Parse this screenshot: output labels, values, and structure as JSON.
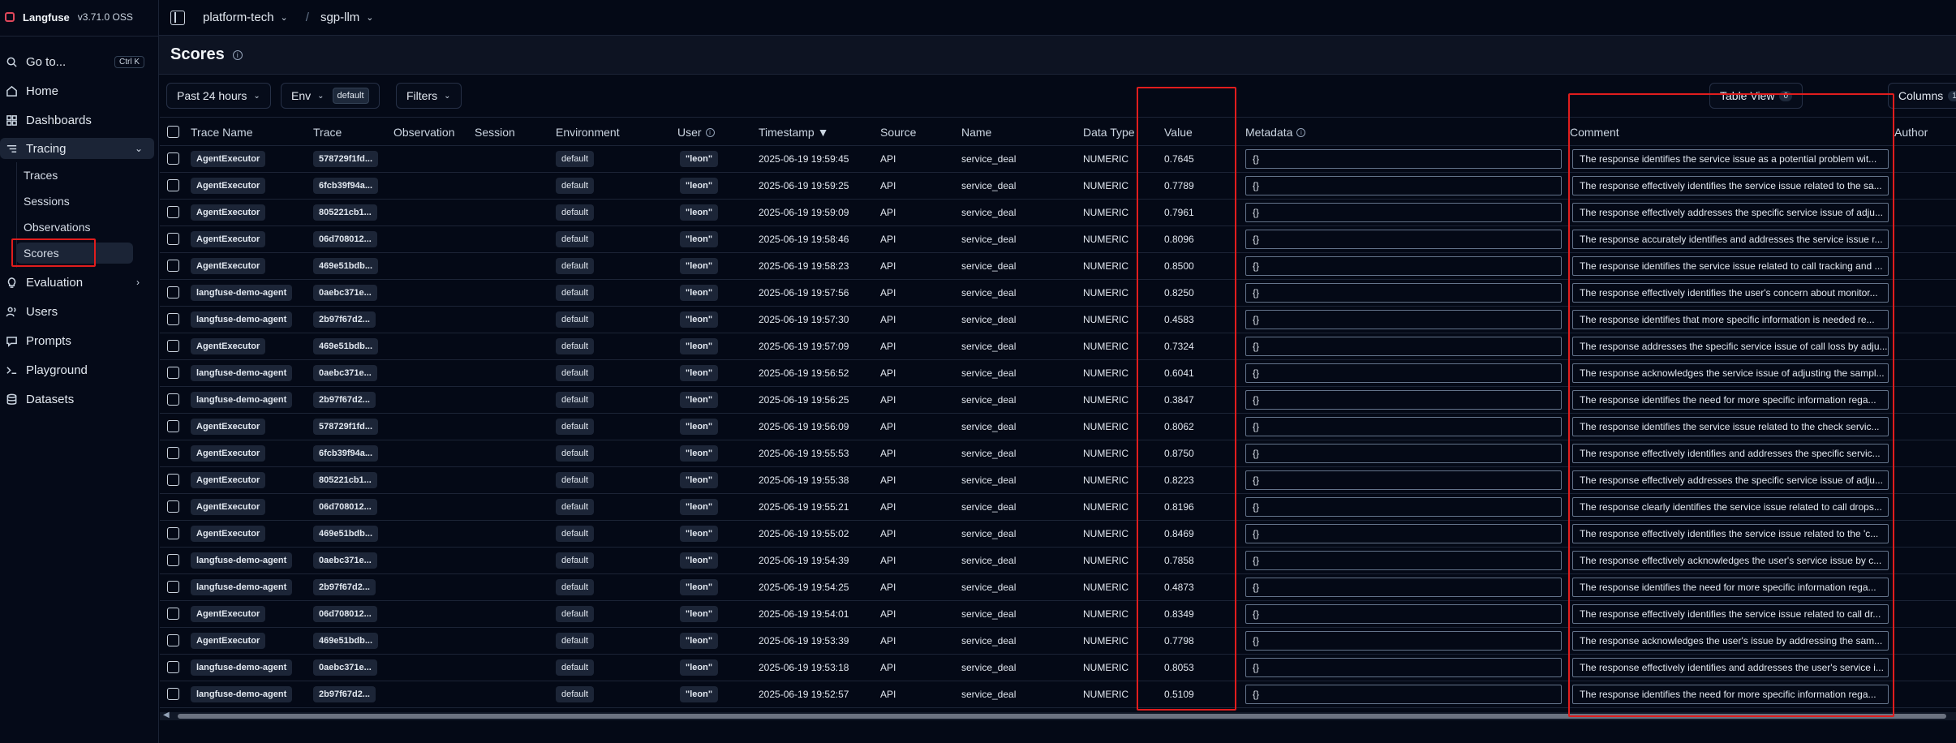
{
  "app": {
    "name": "Langfuse",
    "version": "v3.71.0 OSS"
  },
  "sidebar": {
    "goto": {
      "label": "Go to...",
      "shortcut": "Ctrl K"
    },
    "items": [
      {
        "label": "Home",
        "icon": "home-icon"
      },
      {
        "label": "Dashboards",
        "icon": "dashboard-icon"
      },
      {
        "label": "Tracing",
        "icon": "tracing-icon"
      },
      {
        "label": "Evaluation",
        "icon": "lightbulb-icon"
      },
      {
        "label": "Users",
        "icon": "users-icon"
      },
      {
        "label": "Prompts",
        "icon": "prompts-icon"
      },
      {
        "label": "Playground",
        "icon": "terminal-icon"
      },
      {
        "label": "Datasets",
        "icon": "database-icon"
      }
    ],
    "tracing_sub": [
      "Traces",
      "Sessions",
      "Observations",
      "Scores"
    ]
  },
  "breadcrumb": {
    "org": "platform-tech",
    "separator": "/",
    "project": "sgp-llm"
  },
  "page": {
    "title": "Scores",
    "info_icon": "info-icon"
  },
  "toolbar": {
    "time_range": "Past 24 hours",
    "env_label": "Env",
    "env_value": "default",
    "filters": "Filters",
    "table_view": "Table View",
    "table_view_count": "0",
    "columns": "Columns",
    "columns_count": "1"
  },
  "table": {
    "headers": {
      "trace_name": "Trace Name",
      "trace": "Trace",
      "observation": "Observation",
      "session": "Session",
      "environment": "Environment",
      "user": "User",
      "timestamp": "Timestamp ▼",
      "source": "Source",
      "name": "Name",
      "data_type": "Data Type",
      "value": "Value",
      "metadata": "Metadata",
      "comment": "Comment",
      "author": "Author"
    },
    "rows": [
      {
        "trace_name": "AgentExecutor",
        "trace": "578729f1fd...",
        "env": "default",
        "user": "\"leon\"",
        "ts": "2025-06-19 19:59:45",
        "source": "API",
        "name": "service_deal",
        "dtype": "NUMERIC",
        "value": "0.7645",
        "meta": "{}",
        "comment": "The response identifies the service issue as a potential problem wit..."
      },
      {
        "trace_name": "AgentExecutor",
        "trace": "6fcb39f94a...",
        "env": "default",
        "user": "\"leon\"",
        "ts": "2025-06-19 19:59:25",
        "source": "API",
        "name": "service_deal",
        "dtype": "NUMERIC",
        "value": "0.7789",
        "meta": "{}",
        "comment": "The response effectively identifies the service issue related to the sa..."
      },
      {
        "trace_name": "AgentExecutor",
        "trace": "805221cb1...",
        "env": "default",
        "user": "\"leon\"",
        "ts": "2025-06-19 19:59:09",
        "source": "API",
        "name": "service_deal",
        "dtype": "NUMERIC",
        "value": "0.7961",
        "meta": "{}",
        "comment": "The response effectively addresses the specific service issue of adju..."
      },
      {
        "trace_name": "AgentExecutor",
        "trace": "06d708012...",
        "env": "default",
        "user": "\"leon\"",
        "ts": "2025-06-19 19:58:46",
        "source": "API",
        "name": "service_deal",
        "dtype": "NUMERIC",
        "value": "0.8096",
        "meta": "{}",
        "comment": "The response accurately identifies and addresses the service issue r..."
      },
      {
        "trace_name": "AgentExecutor",
        "trace": "469e51bdb...",
        "env": "default",
        "user": "\"leon\"",
        "ts": "2025-06-19 19:58:23",
        "source": "API",
        "name": "service_deal",
        "dtype": "NUMERIC",
        "value": "0.8500",
        "meta": "{}",
        "comment": "The response identifies the service issue related to call tracking and ..."
      },
      {
        "trace_name": "langfuse-demo-agent",
        "trace": "0aebc371e...",
        "env": "default",
        "user": "\"leon\"",
        "ts": "2025-06-19 19:57:56",
        "source": "API",
        "name": "service_deal",
        "dtype": "NUMERIC",
        "value": "0.8250",
        "meta": "{}",
        "comment": "The response effectively identifies the user's concern about monitor..."
      },
      {
        "trace_name": "langfuse-demo-agent",
        "trace": "2b97f67d2...",
        "env": "default",
        "user": "\"leon\"",
        "ts": "2025-06-19 19:57:30",
        "source": "API",
        "name": "service_deal",
        "dtype": "NUMERIC",
        "value": "0.4583",
        "meta": "{}",
        "comment": "The response identifies that more specific information is needed re..."
      },
      {
        "trace_name": "AgentExecutor",
        "trace": "469e51bdb...",
        "env": "default",
        "user": "\"leon\"",
        "ts": "2025-06-19 19:57:09",
        "source": "API",
        "name": "service_deal",
        "dtype": "NUMERIC",
        "value": "0.7324",
        "meta": "{}",
        "comment": "The response addresses the specific service issue of call loss by adju..."
      },
      {
        "trace_name": "langfuse-demo-agent",
        "trace": "0aebc371e...",
        "env": "default",
        "user": "\"leon\"",
        "ts": "2025-06-19 19:56:52",
        "source": "API",
        "name": "service_deal",
        "dtype": "NUMERIC",
        "value": "0.6041",
        "meta": "{}",
        "comment": "The response acknowledges the service issue of adjusting the sampl..."
      },
      {
        "trace_name": "langfuse-demo-agent",
        "trace": "2b97f67d2...",
        "env": "default",
        "user": "\"leon\"",
        "ts": "2025-06-19 19:56:25",
        "source": "API",
        "name": "service_deal",
        "dtype": "NUMERIC",
        "value": "0.3847",
        "meta": "{}",
        "comment": "The response identifies the need for more specific information rega..."
      },
      {
        "trace_name": "AgentExecutor",
        "trace": "578729f1fd...",
        "env": "default",
        "user": "\"leon\"",
        "ts": "2025-06-19 19:56:09",
        "source": "API",
        "name": "service_deal",
        "dtype": "NUMERIC",
        "value": "0.8062",
        "meta": "{}",
        "comment": "The response identifies the service issue related to the check servic..."
      },
      {
        "trace_name": "AgentExecutor",
        "trace": "6fcb39f94a...",
        "env": "default",
        "user": "\"leon\"",
        "ts": "2025-06-19 19:55:53",
        "source": "API",
        "name": "service_deal",
        "dtype": "NUMERIC",
        "value": "0.8750",
        "meta": "{}",
        "comment": "The response effectively identifies and addresses the specific servic..."
      },
      {
        "trace_name": "AgentExecutor",
        "trace": "805221cb1...",
        "env": "default",
        "user": "\"leon\"",
        "ts": "2025-06-19 19:55:38",
        "source": "API",
        "name": "service_deal",
        "dtype": "NUMERIC",
        "value": "0.8223",
        "meta": "{}",
        "comment": "The response effectively addresses the specific service issue of adju..."
      },
      {
        "trace_name": "AgentExecutor",
        "trace": "06d708012...",
        "env": "default",
        "user": "\"leon\"",
        "ts": "2025-06-19 19:55:21",
        "source": "API",
        "name": "service_deal",
        "dtype": "NUMERIC",
        "value": "0.8196",
        "meta": "{}",
        "comment": "The response clearly identifies the service issue related to call drops..."
      },
      {
        "trace_name": "AgentExecutor",
        "trace": "469e51bdb...",
        "env": "default",
        "user": "\"leon\"",
        "ts": "2025-06-19 19:55:02",
        "source": "API",
        "name": "service_deal",
        "dtype": "NUMERIC",
        "value": "0.8469",
        "meta": "{}",
        "comment": "The response effectively identifies the service issue related to the 'c..."
      },
      {
        "trace_name": "langfuse-demo-agent",
        "trace": "0aebc371e...",
        "env": "default",
        "user": "\"leon\"",
        "ts": "2025-06-19 19:54:39",
        "source": "API",
        "name": "service_deal",
        "dtype": "NUMERIC",
        "value": "0.7858",
        "meta": "{}",
        "comment": "The response effectively acknowledges the user's service issue by c..."
      },
      {
        "trace_name": "langfuse-demo-agent",
        "trace": "2b97f67d2...",
        "env": "default",
        "user": "\"leon\"",
        "ts": "2025-06-19 19:54:25",
        "source": "API",
        "name": "service_deal",
        "dtype": "NUMERIC",
        "value": "0.4873",
        "meta": "{}",
        "comment": "The response identifies the need for more specific information rega..."
      },
      {
        "trace_name": "AgentExecutor",
        "trace": "06d708012...",
        "env": "default",
        "user": "\"leon\"",
        "ts": "2025-06-19 19:54:01",
        "source": "API",
        "name": "service_deal",
        "dtype": "NUMERIC",
        "value": "0.8349",
        "meta": "{}",
        "comment": "The response effectively identifies the service issue related to call dr..."
      },
      {
        "trace_name": "AgentExecutor",
        "trace": "469e51bdb...",
        "env": "default",
        "user": "\"leon\"",
        "ts": "2025-06-19 19:53:39",
        "source": "API",
        "name": "service_deal",
        "dtype": "NUMERIC",
        "value": "0.7798",
        "meta": "{}",
        "comment": "The response acknowledges the user's issue by addressing the sam..."
      },
      {
        "trace_name": "langfuse-demo-agent",
        "trace": "0aebc371e...",
        "env": "default",
        "user": "\"leon\"",
        "ts": "2025-06-19 19:53:18",
        "source": "API",
        "name": "service_deal",
        "dtype": "NUMERIC",
        "value": "0.8053",
        "meta": "{}",
        "comment": "The response effectively identifies and addresses the user's service i..."
      },
      {
        "trace_name": "langfuse-demo-agent",
        "trace": "2b97f67d2...",
        "env": "default",
        "user": "\"leon\"",
        "ts": "2025-06-19 19:52:57",
        "source": "API",
        "name": "service_deal",
        "dtype": "NUMERIC",
        "value": "0.5109",
        "meta": "{}",
        "comment": "The response identifies the need for more specific information rega..."
      }
    ]
  },
  "colors": {
    "highlight": "#e11d1d",
    "background": "#040916"
  }
}
